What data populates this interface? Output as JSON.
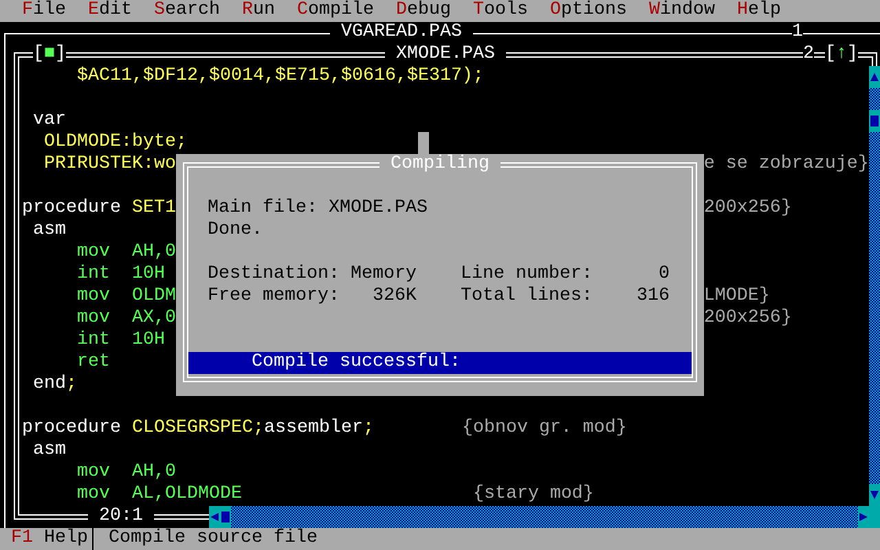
{
  "menu": [
    {
      "label": "File"
    },
    {
      "label": "Edit"
    },
    {
      "label": "Search"
    },
    {
      "label": "Run"
    },
    {
      "label": "Compile"
    },
    {
      "label": "Debug"
    },
    {
      "label": "Tools"
    },
    {
      "label": "Options"
    },
    {
      "label": "Window"
    },
    {
      "label": "Help"
    }
  ],
  "back_window": {
    "title": "VGAREAD.PAS",
    "number": "1"
  },
  "editor": {
    "title": "XMODE.PAS",
    "number": "2",
    "close_button": "[■]",
    "zoom_button": "[↑]",
    "position": "20:1",
    "lines": [
      {
        "kind": "code",
        "segments": [
          {
            "text": "     $AC11,$DF12,$0014,$E715,$0616,$E317);",
            "kind": "ident"
          }
        ]
      },
      {
        "kind": "blank"
      },
      {
        "kind": "code",
        "segments": [
          {
            "text": " var",
            "kind": "keyword"
          }
        ]
      },
      {
        "kind": "code",
        "segments": [
          {
            "text": "  OLDMODE:byte;",
            "kind": "ident"
          }
        ]
      },
      {
        "kind": "code",
        "segments": [
          {
            "text": "  PRIRUSTEK:wo",
            "kind": "ident"
          },
          {
            "text": "                                                e se zobrazuje}",
            "kind": "comment"
          }
        ]
      },
      {
        "kind": "blank"
      },
      {
        "kind": "code",
        "segments": [
          {
            "text": "procedure",
            "kind": "keyword"
          },
          {
            "text": " SET1",
            "kind": "ident"
          },
          {
            "text": "                                                200x256}",
            "kind": "comment"
          }
        ]
      },
      {
        "kind": "code",
        "segments": [
          {
            "text": " asm",
            "kind": "keyword"
          }
        ]
      },
      {
        "kind": "code",
        "segments": [
          {
            "text": "     mov  AH,0",
            "kind": "asm"
          }
        ]
      },
      {
        "kind": "code",
        "segments": [
          {
            "text": "     int  10H",
            "kind": "asm"
          }
        ]
      },
      {
        "kind": "code",
        "segments": [
          {
            "text": "     mov  OLDM",
            "kind": "asm"
          },
          {
            "text": "                                                LMODE}",
            "kind": "comment"
          }
        ]
      },
      {
        "kind": "code",
        "segments": [
          {
            "text": "     mov  AX,0",
            "kind": "asm"
          },
          {
            "text": "                                                200x256}",
            "kind": "comment"
          }
        ]
      },
      {
        "kind": "code",
        "segments": [
          {
            "text": "     int  10H",
            "kind": "asm"
          }
        ]
      },
      {
        "kind": "code",
        "segments": [
          {
            "text": "     ret",
            "kind": "asm"
          }
        ]
      },
      {
        "kind": "code",
        "segments": [
          {
            "text": " end",
            "kind": "keyword"
          },
          {
            "text": ";",
            "kind": "ident"
          }
        ]
      },
      {
        "kind": "blank"
      },
      {
        "kind": "code",
        "segments": [
          {
            "text": "procedure",
            "kind": "keyword"
          },
          {
            "text": " CLOSEGRSPEC;",
            "kind": "ident"
          },
          {
            "text": "assembler",
            "kind": "keyword"
          },
          {
            "text": ";",
            "kind": "ident"
          },
          {
            "text": "        {obnov gr. mod}",
            "kind": "comment"
          }
        ]
      },
      {
        "kind": "code",
        "segments": [
          {
            "text": " asm",
            "kind": "keyword"
          }
        ]
      },
      {
        "kind": "code",
        "segments": [
          {
            "text": "     mov  AH,0",
            "kind": "asm"
          }
        ]
      },
      {
        "kind": "code",
        "segments": [
          {
            "text": "     mov  AL,OLDMODE",
            "kind": "asm"
          },
          {
            "text": "                     {stary mod}",
            "kind": "comment"
          }
        ]
      }
    ]
  },
  "dialog": {
    "title": "Compiling",
    "main_file": "Main file: XMODE.PAS",
    "status": "Done.",
    "fields": [
      {
        "label": "Destination:",
        "value": "Memory"
      },
      {
        "label": "Line number:",
        "value": "0"
      },
      {
        "label": "Free memory:",
        "value": "326K"
      },
      {
        "label": "Total lines:",
        "value": "316"
      }
    ],
    "message": "Compile successful:"
  },
  "status_bar": {
    "key": "F1",
    "key_label": "Help",
    "hint": "Compile source file"
  }
}
